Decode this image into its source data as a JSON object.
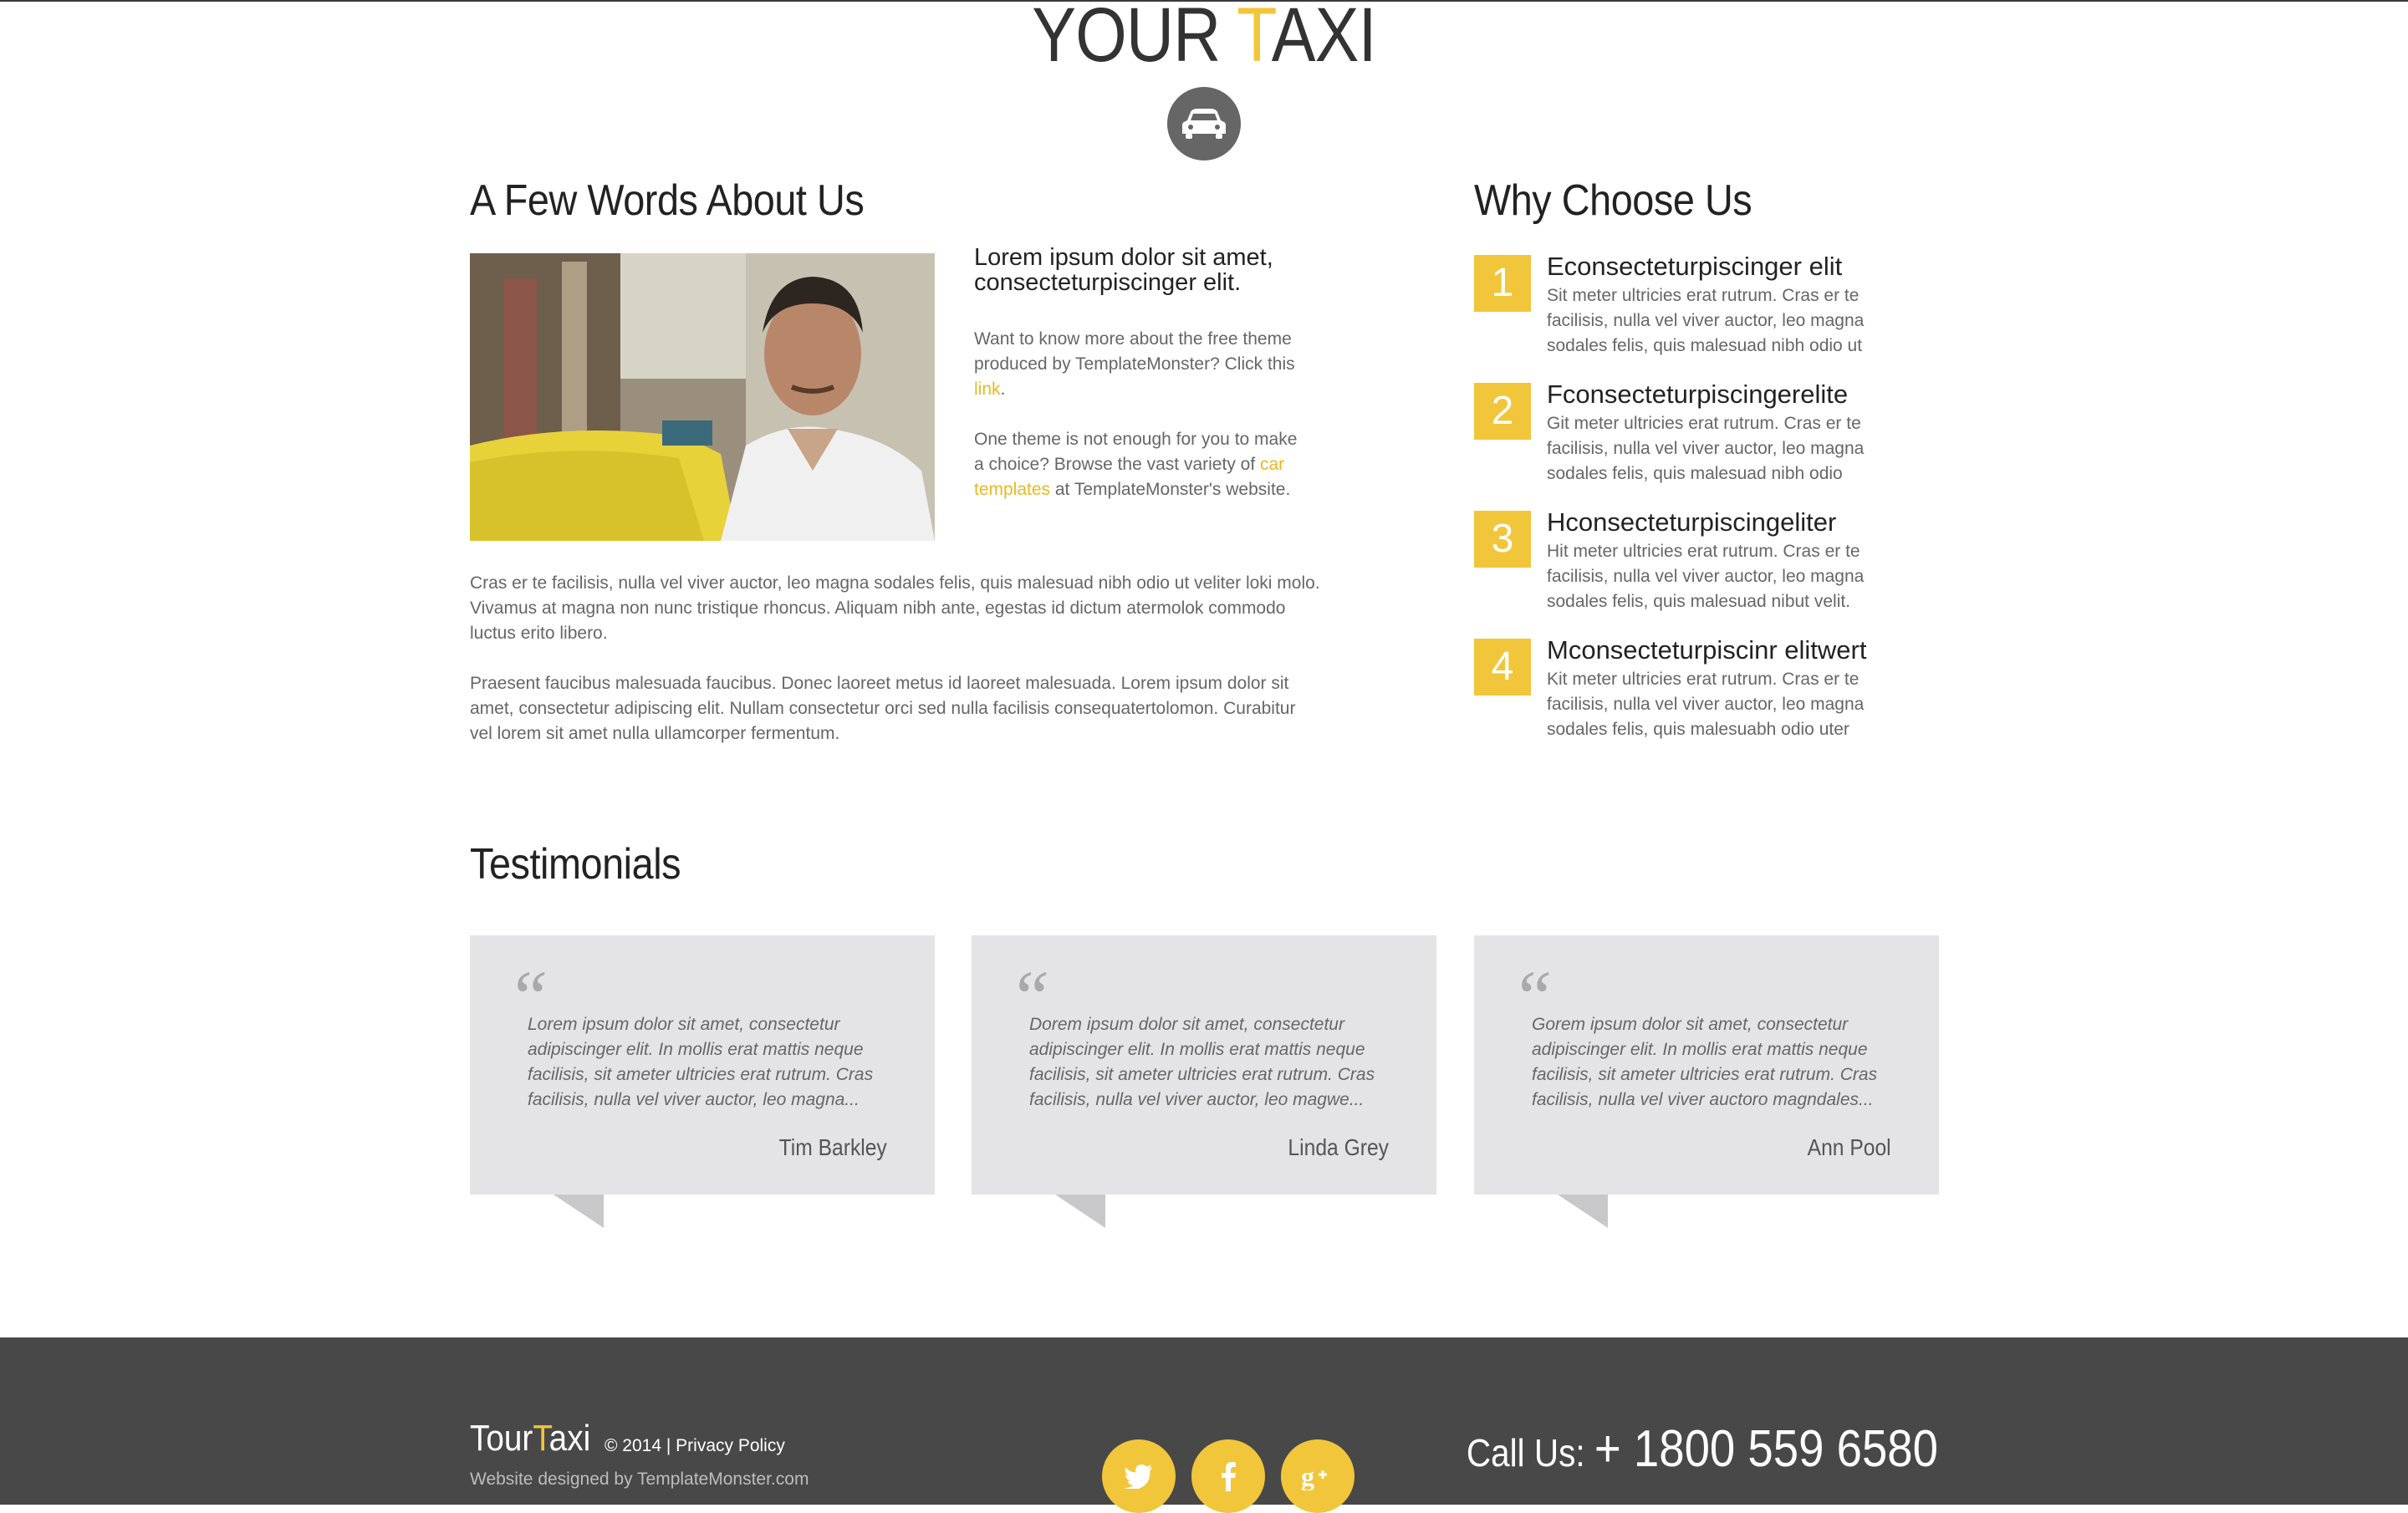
{
  "header": {
    "logo_part1": "YOUR ",
    "logo_accent": "T",
    "logo_part2": "AXI"
  },
  "about": {
    "title": "A Few Words About Us",
    "lead": "Lorem ipsum dolor sit amet, consecteturpiscinger elit.",
    "p1_text": "Want to know more about the free theme produced by TemplateMonster? Click this ",
    "p1_link": "link",
    "p1_end": ".",
    "p2_text": "One theme is not enough for you to make a choice? Browse the vast variety of ",
    "p2_link": "car templates",
    "p2_end": " at TemplateMonster's website.",
    "p3": "Cras er te facilisis, nulla vel viver auctor, leo magna sodales felis, quis malesuad nibh odio ut veliter loki molo. Vivamus at magna non nunc tristique rhoncus. Aliquam nibh ante, egestas id dictum atermolok commodo luctus erito libero.",
    "p4": "Praesent faucibus malesuada faucibus. Donec laoreet metus id laoreet malesuada. Lorem ipsum dolor sit amet, consectetur adipiscing elit. Nullam consectetur orci sed nulla facilisis consequatertolomon. Curabitur vel lorem sit amet nulla ullamcorper fermentum."
  },
  "why": {
    "title": "Why Choose Us",
    "items": [
      {
        "num": "1",
        "title": "Econsecteturpiscinger elit",
        "text": "Sit meter ultricies erat rutrum. Cras er te facilisis, nulla vel viver auctor, leo magna sodales felis, quis malesuad nibh odio ut"
      },
      {
        "num": "2",
        "title": "Fconsecteturpiscingerelite",
        "text": "Git meter ultricies erat rutrum. Cras er te facilisis, nulla vel viver auctor, leo magna sodales felis, quis malesuad nibh odio"
      },
      {
        "num": "3",
        "title": "Hconsecteturpiscingeliter",
        "text": "Hit meter ultricies erat rutrum. Cras er te facilisis, nulla vel viver auctor, leo magna sodales felis, quis malesuad nibut velit."
      },
      {
        "num": "4",
        "title": "Mconsecteturpiscinr elitwert",
        "text": "Kit meter ultricies erat rutrum. Cras er te facilisis, nulla vel viver auctor, leo magna sodales felis, quis malesuabh odio uter"
      }
    ]
  },
  "testimonials": {
    "title": "Testimonials",
    "quote_mark": "“",
    "items": [
      {
        "text": "Lorem ipsum dolor sit amet, consectetur adipiscinger elit. In mollis erat mattis neque facilisis, sit ameter ultricies erat rutrum. Cras facilisis, nulla vel viver auctor, leo magna...",
        "author": "Tim Barkley"
      },
      {
        "text": "Dorem ipsum dolor sit amet, consectetur adipiscinger elit. In mollis erat mattis neque facilisis, sit ameter ultricies erat rutrum. Cras facilisis, nulla vel viver auctor, leo magwe...",
        "author": "Linda Grey"
      },
      {
        "text": "Gorem ipsum dolor sit amet, consectetur adipiscinger elit. In mollis erat mattis neque facilisis, sit ameter ultricies erat rutrum. Cras facilisis, nulla vel viver auctoro magndales...",
        "author": "Ann Pool"
      }
    ]
  },
  "footer": {
    "brand_part1": "Tour",
    "brand_accent": "T",
    "brand_part2": "axi",
    "copyright": "© 2014 | ",
    "privacy": "Privacy Policy",
    "credit": "Website designed by TemplateMonster.com",
    "call_label": "Call Us: ",
    "phone": "+ 1800 559 6580",
    "social": [
      {
        "name": "twitter-icon",
        "glyph": "t"
      },
      {
        "name": "facebook-icon",
        "glyph": "f"
      },
      {
        "name": "google-plus-icon",
        "glyph": "g+"
      }
    ]
  },
  "colors": {
    "accent": "#f2c63a",
    "footer_bg": "#484848",
    "card_bg": "#e4e4e6"
  }
}
